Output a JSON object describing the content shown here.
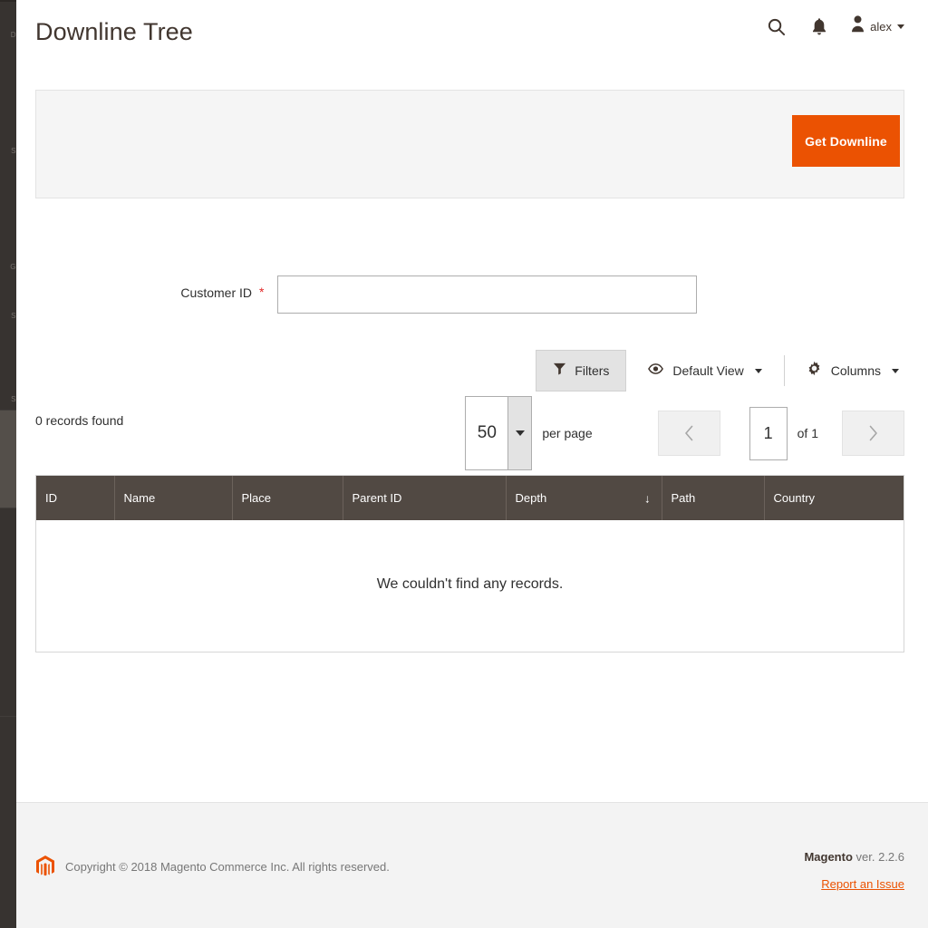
{
  "sidebar": {
    "items": [
      {
        "label": "D"
      },
      {
        "label": "S"
      },
      {
        "label": "G"
      },
      {
        "label": "S"
      },
      {
        "label": "S"
      }
    ]
  },
  "header": {
    "title": "Downline Tree",
    "search_icon": "search-icon",
    "notifications_icon": "bell-icon",
    "user_icon": "user-icon",
    "user_name": "alex"
  },
  "action_panel": {
    "get_downline_label": "Get Downline"
  },
  "form": {
    "customer_id_label": "Customer ID",
    "required_marker": "*",
    "customer_id_value": "",
    "customer_id_placeholder": ""
  },
  "toolbar": {
    "filters_label": "Filters",
    "filters_icon": "funnel-icon",
    "view_label": "Default View",
    "view_icon": "eye-icon",
    "columns_label": "Columns",
    "columns_icon": "gear-icon"
  },
  "grid_status": {
    "records_found": "0 records found"
  },
  "pagination": {
    "per_page_value": "50",
    "per_page_label": "per page",
    "prev_icon": "chevron-left-icon",
    "next_icon": "chevron-right-icon",
    "current_page": "1",
    "of_label": "of 1"
  },
  "grid": {
    "columns": [
      {
        "label": "ID",
        "sorted": false
      },
      {
        "label": "Name",
        "sorted": false
      },
      {
        "label": "Place",
        "sorted": false
      },
      {
        "label": "Parent ID",
        "sorted": false
      },
      {
        "label": "Depth",
        "sorted": true,
        "sort_indicator": "↓"
      },
      {
        "label": "Path",
        "sorted": false
      },
      {
        "label": "Country",
        "sorted": false
      }
    ],
    "rows": [],
    "empty_message": "We couldn't find any records."
  },
  "footer": {
    "logo_icon": "magento-logo-icon",
    "copyright": "Copyright © 2018 Magento Commerce Inc. All rights reserved.",
    "version_brand": "Magento",
    "version_text": " ver. 2.2.6",
    "report_link": "Report an Issue"
  },
  "colors": {
    "accent_orange": "#eb5202",
    "sidebar_dark": "#373330",
    "grid_header": "#514943",
    "required_red": "#e22626"
  }
}
